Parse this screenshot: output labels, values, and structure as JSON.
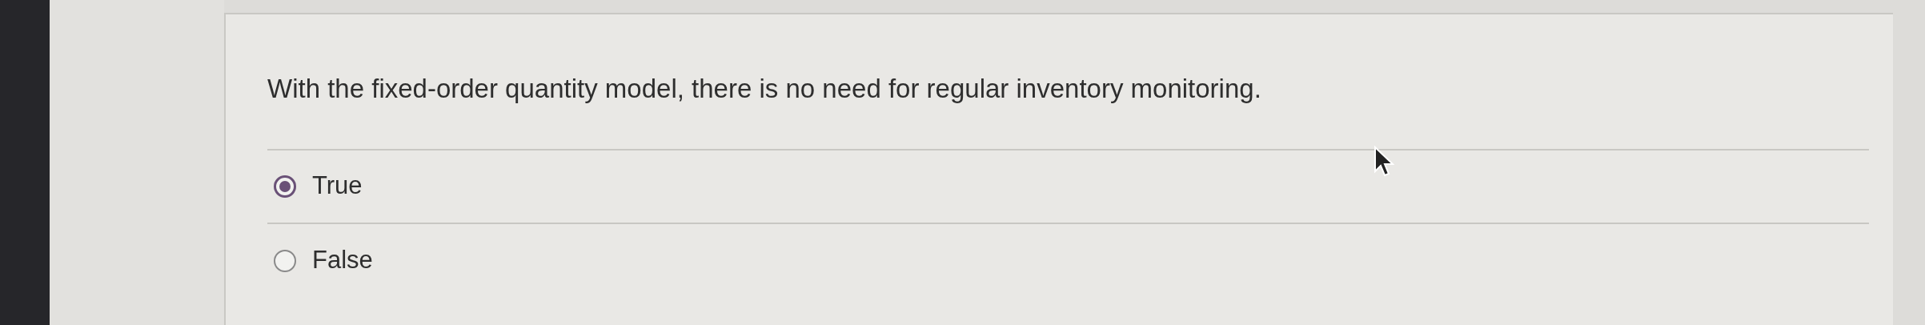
{
  "question": {
    "text": "With the ﬁxed-order quantity model, there is no need for regular inventory monitoring."
  },
  "options": [
    {
      "label": "True",
      "selected": true
    },
    {
      "label": "False",
      "selected": false
    }
  ]
}
